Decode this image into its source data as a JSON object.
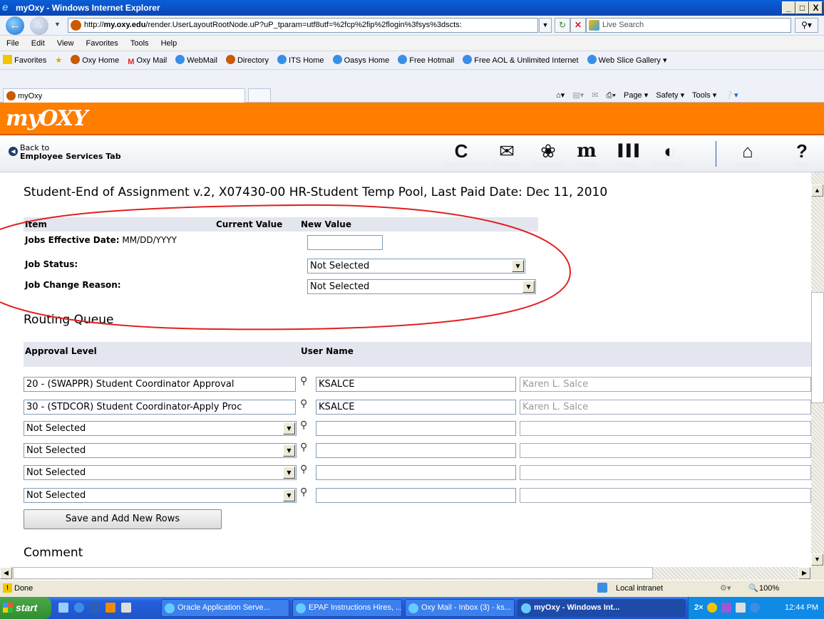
{
  "window": {
    "title": "myOxy - Windows Internet Explorer",
    "min": "_",
    "max": "□",
    "close": "X"
  },
  "browser": {
    "url_domain": "my.oxy.edu",
    "url_prefix": "http://",
    "url_rest": "/render.UserLayoutRootNode.uP?uP_tparam=utf8utf=%2fcp%2fip%2flogin%3fsys%3dscts:",
    "search_placeholder": "Live Search",
    "menu": [
      "File",
      "Edit",
      "View",
      "Favorites",
      "Tools",
      "Help"
    ],
    "favorites_label": "Favorites",
    "favorites": [
      "Oxy Home",
      "Oxy Mail",
      "WebMail",
      "Directory",
      "ITS Home",
      "Oasys Home",
      "Free Hotmail",
      "Free AOL & Unlimited Internet",
      "Web Slice Gallery ▾"
    ],
    "tab": "myOxy",
    "commands": [
      "Page ▾",
      "Safety ▾",
      "Tools ▾"
    ]
  },
  "portal": {
    "logo": "myOXY",
    "back_line1": "Back to",
    "back_line2": "Employee Services Tab",
    "nav": [
      {
        "label": "OxyCONNECT",
        "icon": "oxyconnect-icon",
        "glyph": "C"
      },
      {
        "label": "Webmail",
        "icon": "envelope-icon",
        "glyph": "✉"
      },
      {
        "label": "Oxypedia",
        "icon": "paw-icon",
        "glyph": "❀"
      },
      {
        "label": "Moodle",
        "icon": "moodle-icon",
        "glyph": "m"
      },
      {
        "label": "Library",
        "icon": "books-icon",
        "glyph": "▐▐▐"
      },
      {
        "label": "Feedback",
        "icon": "speech-bubble-icon",
        "glyph": "◐"
      },
      {
        "label": "Logout",
        "icon": "lock-icon",
        "glyph": "⌂"
      },
      {
        "label": "Help",
        "icon": "question-icon",
        "glyph": "?"
      }
    ]
  },
  "form": {
    "heading": "Student-End of Assignment v.2, X07430-00 HR-Student Temp Pool, Last Paid Date: Dec 11, 2010",
    "col_item": "Item",
    "col_current": "Current Value",
    "col_new": "New Value",
    "rows": [
      {
        "label": "Jobs Effective Date:",
        "hint": "MM/DD/YYYY",
        "value": ""
      },
      {
        "label": "Job Status:",
        "value": "Not Selected"
      },
      {
        "label": "Job Change Reason:",
        "value": "Not Selected"
      }
    ],
    "routing_title": "Routing Queue",
    "col_approval": "Approval Level",
    "col_user": "User Name",
    "routing": [
      {
        "level": "20 - (SWAPPR) Student Coordinator Approval",
        "user": "KSALCE",
        "name": "Karen L. Salce",
        "select": false
      },
      {
        "level": "30 - (STDCOR) Student Coordinator-Apply Proc",
        "user": "KSALCE",
        "name": "Karen L. Salce",
        "select": false
      },
      {
        "level": "Not Selected",
        "user": "",
        "name": "",
        "select": true
      },
      {
        "level": "Not Selected",
        "user": "",
        "name": "",
        "select": true
      },
      {
        "level": "Not Selected",
        "user": "",
        "name": "",
        "select": true
      },
      {
        "level": "Not Selected",
        "user": "",
        "name": "",
        "select": true
      }
    ],
    "save_button": "Save and Add New Rows",
    "comment_title": "Comment"
  },
  "statusbar": {
    "text": "Done",
    "zone": "Local intranet",
    "zoom": "100%"
  },
  "taskbar": {
    "start": "start",
    "tasks": [
      {
        "label": "Oracle Application Serve...",
        "active": false
      },
      {
        "label": "EPAF Instructions Hires, ...",
        "active": false
      },
      {
        "label": "Oxy Mail - Inbox (3) - ks...",
        "active": false
      },
      {
        "label": "myOxy - Windows Int...",
        "active": true
      }
    ],
    "tray_count": "2×",
    "clock": "12:44 PM"
  },
  "colors": {
    "banner": "#ff7e00",
    "annotation": "#e02020"
  }
}
